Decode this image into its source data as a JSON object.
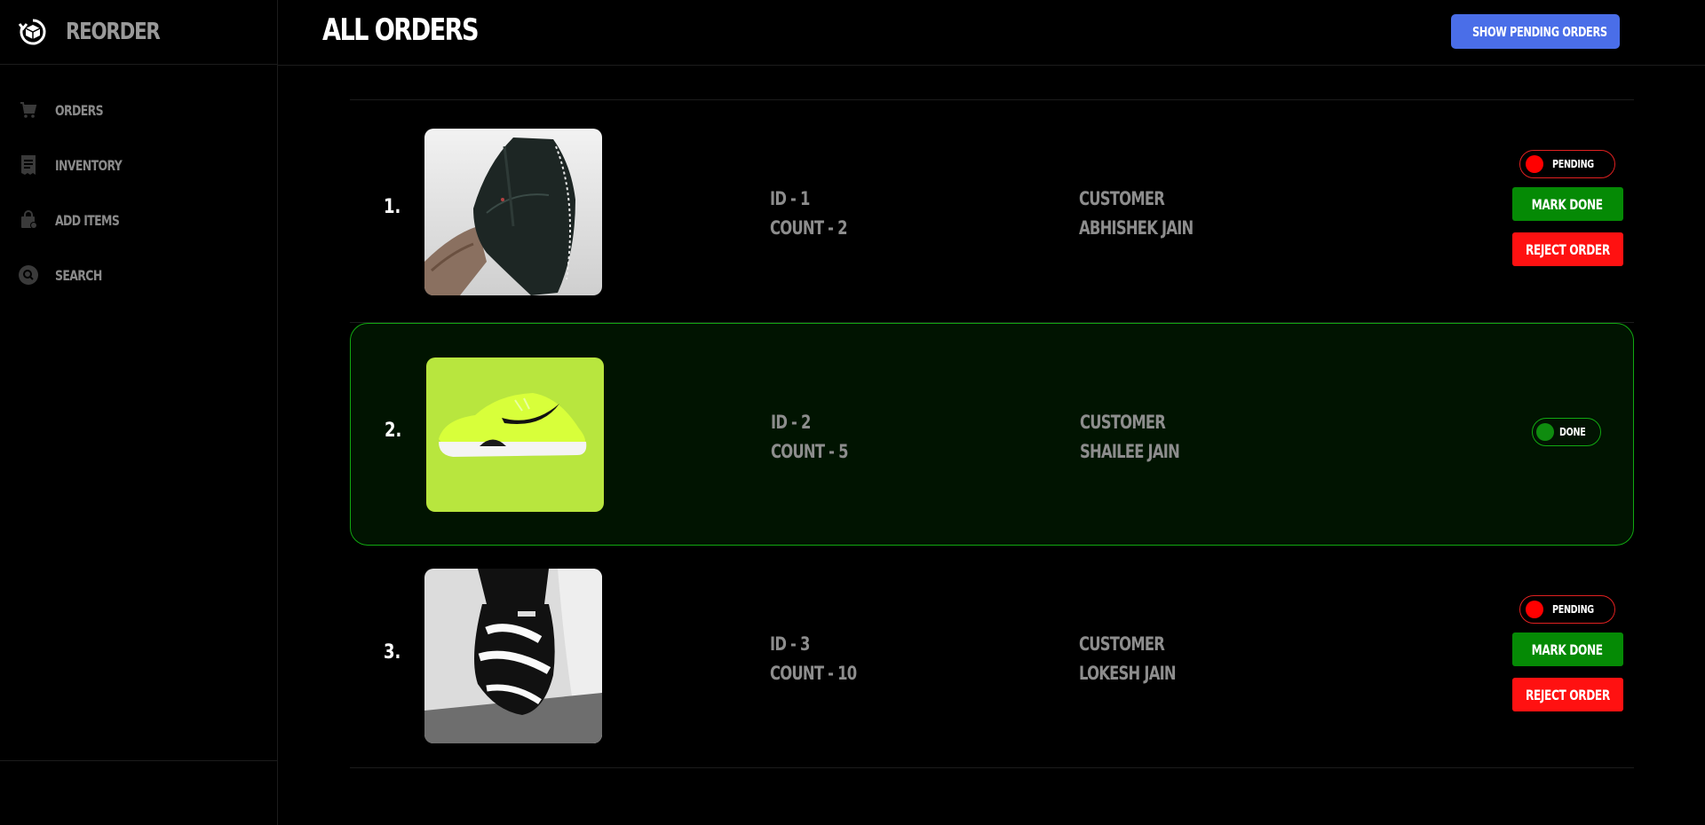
{
  "app": {
    "name": "REORDER"
  },
  "sidebar": {
    "items": [
      {
        "label": "ORDERS",
        "icon": "cart-icon"
      },
      {
        "label": "INVENTORY",
        "icon": "receipt-icon"
      },
      {
        "label": "ADD ITEMS",
        "icon": "shopping-bag-icon"
      },
      {
        "label": "SEARCH",
        "icon": "search-icon"
      }
    ]
  },
  "header": {
    "title": "ALL ORDERS",
    "show_pending_label": "SHOW PENDING ORDERS"
  },
  "colors": {
    "accent_blue": "#4a6ee8",
    "done_green": "#058a05",
    "reject_red": "#ff1111",
    "done_row_border": "#11a811"
  },
  "orders": [
    {
      "index": "1.",
      "id_text": "ID - 1",
      "count_text": "COUNT - 2",
      "customer_label": "CUSTOMER",
      "customer_name": "ABHISHEK JAIN",
      "status": "PENDING",
      "image": "black-low-top-sneaker",
      "mark_done_label": "MARK DONE",
      "reject_label": "REJECT ORDER"
    },
    {
      "index": "2.",
      "id_text": "ID - 2",
      "count_text": "COUNT - 5",
      "customer_label": "CUSTOMER",
      "customer_name": "SHAILEE JAIN",
      "status": "DONE",
      "image": "lime-running-shoe"
    },
    {
      "index": "3.",
      "id_text": "ID - 3",
      "count_text": "COUNT - 10",
      "customer_label": "CUSTOMER",
      "customer_name": "LOKESH JAIN",
      "status": "PENDING",
      "image": "black-white-high-top-sneaker",
      "mark_done_label": "MARK DONE",
      "reject_label": "REJECT ORDER"
    }
  ]
}
